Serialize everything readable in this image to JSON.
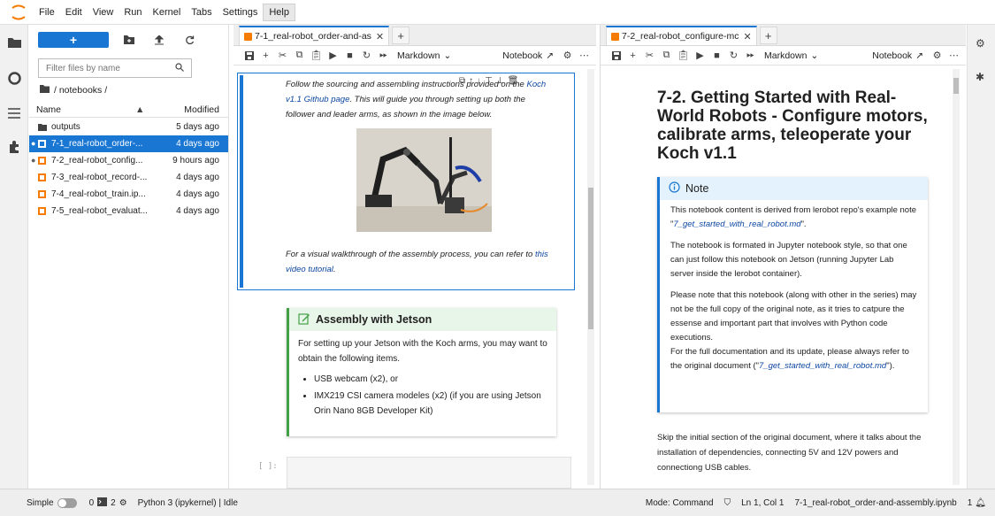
{
  "menubar": {
    "items": [
      "File",
      "Edit",
      "View",
      "Run",
      "Kernel",
      "Tabs",
      "Settings",
      "Help"
    ],
    "active_index": 7
  },
  "filebrowser": {
    "filter_placeholder": "Filter files by name",
    "breadcrumb": "/ notebooks /",
    "col_name": "Name",
    "col_modified": "Modified",
    "files": [
      {
        "name": "outputs",
        "modified": "5 days ago",
        "type": "folder",
        "open": false,
        "selected": false
      },
      {
        "name": "7-1_real-robot_order-...",
        "modified": "4 days ago",
        "type": "notebook",
        "open": true,
        "selected": true
      },
      {
        "name": "7-2_real-robot_config...",
        "modified": "9 hours ago",
        "type": "notebook",
        "open": true,
        "selected": false
      },
      {
        "name": "7-3_real-robot_record-...",
        "modified": "4 days ago",
        "type": "notebook",
        "open": false,
        "selected": false
      },
      {
        "name": "7-4_real-robot_train.ip...",
        "modified": "4 days ago",
        "type": "notebook",
        "open": false,
        "selected": false
      },
      {
        "name": "7-5_real-robot_evaluat...",
        "modified": "4 days ago",
        "type": "notebook",
        "open": false,
        "selected": false
      }
    ]
  },
  "left_panel": {
    "tab_title": "7-1_real-robot_order-and-as",
    "cell_type": "Markdown",
    "kernel_label": "Notebook",
    "cell1": {
      "text1a": "Follow the sourcing and assembling instructions provided on the ",
      "link1": "Koch v1.1 Github page",
      "text1b": ". This will guide you through setting up both the follower and leader arms, as shown in the image below.",
      "text2a": "For a visual walkthrough of the assembly process, you can refer to ",
      "link2": "this video tutorial",
      "text2b": "."
    },
    "callout": {
      "title": "Assembly with Jetson",
      "body": "For setting up your Jetson with the Koch arms, you may want to obtain the following items.",
      "items": [
        "USB webcam (x2), or",
        "IMX219 CSI camera modeles (x2) (if you are using Jetson Orin Nano 8GB Developer Kit)"
      ]
    },
    "code_prompt": "[ ]:"
  },
  "right_panel": {
    "tab_title": "7-2_real-robot_configure-mc",
    "cell_type": "Markdown",
    "kernel_label": "Notebook",
    "heading": "7-2. Getting Started with Real-World Robots - Configure motors, calibrate arms, teleoperate your Koch v1.1",
    "note": {
      "title": "Note",
      "p1a": "This notebook content is derived from lerobot repo's example note \"",
      "p1link": "7_get_started_with_real_robot.md",
      "p1b": "\".",
      "p2": "The notebook is formated in Jupyter notebook style, so that one can just follow this notebook on Jetson (running Jupyter Lab server inside the lerobot container).",
      "p3": "Please note that this notebook (along with other in the series) may not be the full copy of the original note, as it tries to catpure the essense and important part that involves with Python code executions.",
      "p4a": "For the full documentation and its update, please always refer to the original document (\"",
      "p4link": "7_get_started_with_real_robot.md",
      "p4b": "\")."
    },
    "skip_text": "Skip the initial section of the original document, where it talks about the installation of dependencies, connecting 5V and 12V powers and connectiong USB cables."
  },
  "statusbar": {
    "mode_label": "Simple",
    "count1": "0",
    "count2": "2",
    "kernel": "Python 3 (ipykernel) | Idle",
    "mode": "Mode: Command",
    "position": "Ln 1, Col 1",
    "file": "7-1_real-robot_order-and-assembly.ipynb",
    "notifications": "1"
  },
  "colors": {
    "accent": "#1976d2",
    "notebook_icon": "#f57c00",
    "callout_green": "#43a047"
  }
}
